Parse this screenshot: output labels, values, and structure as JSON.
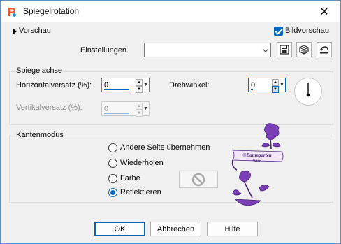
{
  "window": {
    "title": "Spiegelrotation",
    "close_glyph": "✕"
  },
  "top": {
    "preview_toggle": "Vorschau",
    "preview_toggle_icon": "triangle-right-icon",
    "bildvorschau_label": "Bildvorschau",
    "bildvorschau_checked": true,
    "settings_label": "Einstellungen",
    "settings_value": ""
  },
  "spiegelachse": {
    "title": "Spiegelachse",
    "horiz_label": "Horizontalversatz (%):",
    "horiz_value": "0",
    "vert_label": "Vertikalversatz (%):",
    "vert_value": "0",
    "vert_disabled": true,
    "rotation_label": "Drehwinkel:",
    "rotation_value": "0",
    "rotation_dial_icon": "angle-dial-icon"
  },
  "kantenmodus": {
    "title": "Kantenmodus",
    "options": [
      {
        "label": "Andere Seite übernehmen",
        "checked": false
      },
      {
        "label": "Wiederholen",
        "checked": false
      },
      {
        "label": "Farbe",
        "checked": false
      },
      {
        "label": "Reflektieren",
        "checked": true
      }
    ],
    "color_swatch_icon": "no-color-icon"
  },
  "watermark": {
    "line1": "©Baumgarten",
    "line2": "Wien"
  },
  "footer": {
    "ok": "OK",
    "cancel": "Abbrechen",
    "help": "Hilfe"
  },
  "colors": {
    "accent": "#0067c0",
    "watermark": "#7b3fb5"
  }
}
